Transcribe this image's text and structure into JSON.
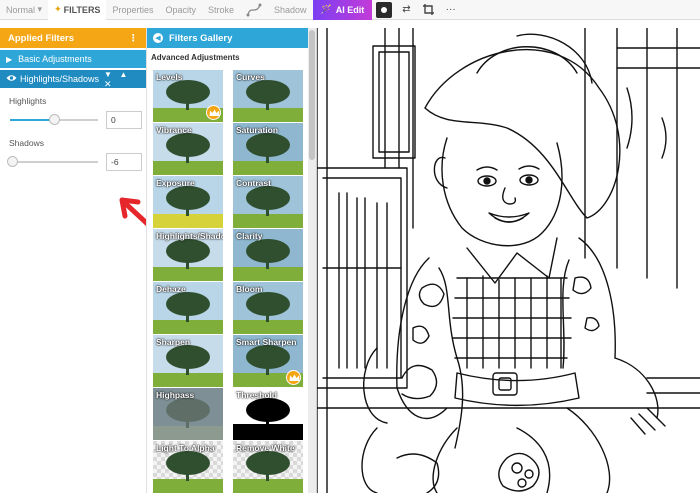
{
  "toolbar": {
    "blend_mode": "Normal",
    "filters_label": "FILTERS",
    "properties_label": "Properties",
    "opacity_label": "Opacity",
    "stroke_label": "Stroke",
    "shadow_label": "Shadow",
    "ai_edit_label": "AI Edit",
    "more_label": "···"
  },
  "applied_filters": {
    "title": "Applied Filters",
    "sections": [
      {
        "label": "Basic Adjustments",
        "expanded": false
      },
      {
        "label": "Highlights/Shadows",
        "expanded": true
      }
    ],
    "params": [
      {
        "label": "Highlights",
        "value": "0",
        "level_fraction": 0.5
      },
      {
        "label": "Shadows",
        "value": "-6",
        "level_fraction": 0.02
      }
    ]
  },
  "gallery": {
    "title": "Filters Gallery",
    "subtitle": "Advanced Adjustments",
    "tiles": [
      {
        "label": "Levels",
        "premium": true
      },
      {
        "label": "Curves",
        "premium": false
      },
      {
        "label": "Vibrance",
        "premium": false
      },
      {
        "label": "Saturation",
        "premium": false
      },
      {
        "label": "Exposure",
        "premium": false
      },
      {
        "label": "Contrast",
        "premium": false
      },
      {
        "label": "Highlights/Shadows",
        "premium": false
      },
      {
        "label": "Clarity",
        "premium": false
      },
      {
        "label": "Dehaze",
        "premium": false
      },
      {
        "label": "Bloom",
        "premium": false
      },
      {
        "label": "Sharpen",
        "premium": false
      },
      {
        "label": "Smart Sharpen",
        "premium": true
      },
      {
        "label": "Highpass",
        "premium": false
      },
      {
        "label": "Threshold",
        "premium": false
      },
      {
        "label": "Light To Alpha",
        "premium": false
      },
      {
        "label": "Remove White",
        "premium": false
      }
    ]
  },
  "colors": {
    "orange": "#f5a615",
    "blue": "#2ea6d8",
    "arrow_red": "#e5262b",
    "ai_purple": "#7b3ff2"
  }
}
